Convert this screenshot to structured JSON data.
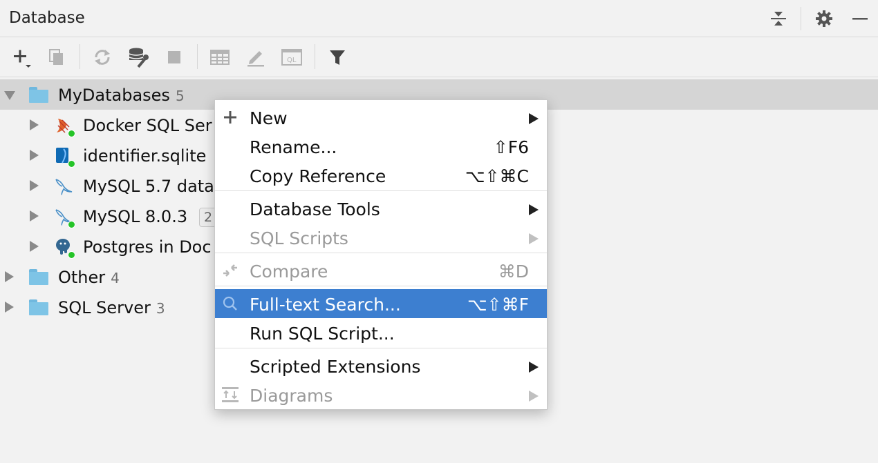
{
  "panel": {
    "title": "Database",
    "header_icons": [
      "collapse-all-icon",
      "gear-icon",
      "minimize-icon"
    ]
  },
  "toolbar": {
    "buttons": [
      "add-icon",
      "duplicate-icon",
      "refresh-icon",
      "data-source-properties-icon",
      "stop-icon",
      "table-editor-icon",
      "edit-source-icon",
      "sql-console-icon",
      "filter-icon"
    ]
  },
  "tree": {
    "root": {
      "label": "MyDatabases",
      "count": "5"
    },
    "children": [
      {
        "label": "Docker SQL Ser",
        "icon": "sql-server-icon"
      },
      {
        "label": "identifier.sqlite",
        "icon": "sqlite-icon"
      },
      {
        "label": "MySQL 5.7 data",
        "icon": "mysql-icon"
      },
      {
        "label": "MySQL 8.0.3",
        "badge": "2",
        "icon": "mysql-icon"
      },
      {
        "label": "Postgres in Doc",
        "icon": "postgres-icon"
      }
    ],
    "other": {
      "label": "Other",
      "count": "4"
    },
    "sqlserver": {
      "label": "SQL Server",
      "count": "3"
    }
  },
  "menu": {
    "new": {
      "label": "New"
    },
    "rename": {
      "label": "Rename...",
      "shortcut": "⇧F6"
    },
    "copy_reference": {
      "label": "Copy Reference",
      "shortcut": "⌥⇧⌘C"
    },
    "database_tools": {
      "label": "Database Tools"
    },
    "sql_scripts": {
      "label": "SQL Scripts"
    },
    "compare": {
      "label": "Compare",
      "shortcut": "⌘D"
    },
    "fulltext": {
      "label": "Full-text Search...",
      "shortcut": "⌥⇧⌘F"
    },
    "run_sql": {
      "label": "Run SQL Script..."
    },
    "scripted_ext": {
      "label": "Scripted Extensions"
    },
    "diagrams": {
      "label": "Diagrams"
    }
  },
  "colors": {
    "selection": "#3d7fd0",
    "folder": "#7ec4e6",
    "status_green": "#25c428"
  }
}
